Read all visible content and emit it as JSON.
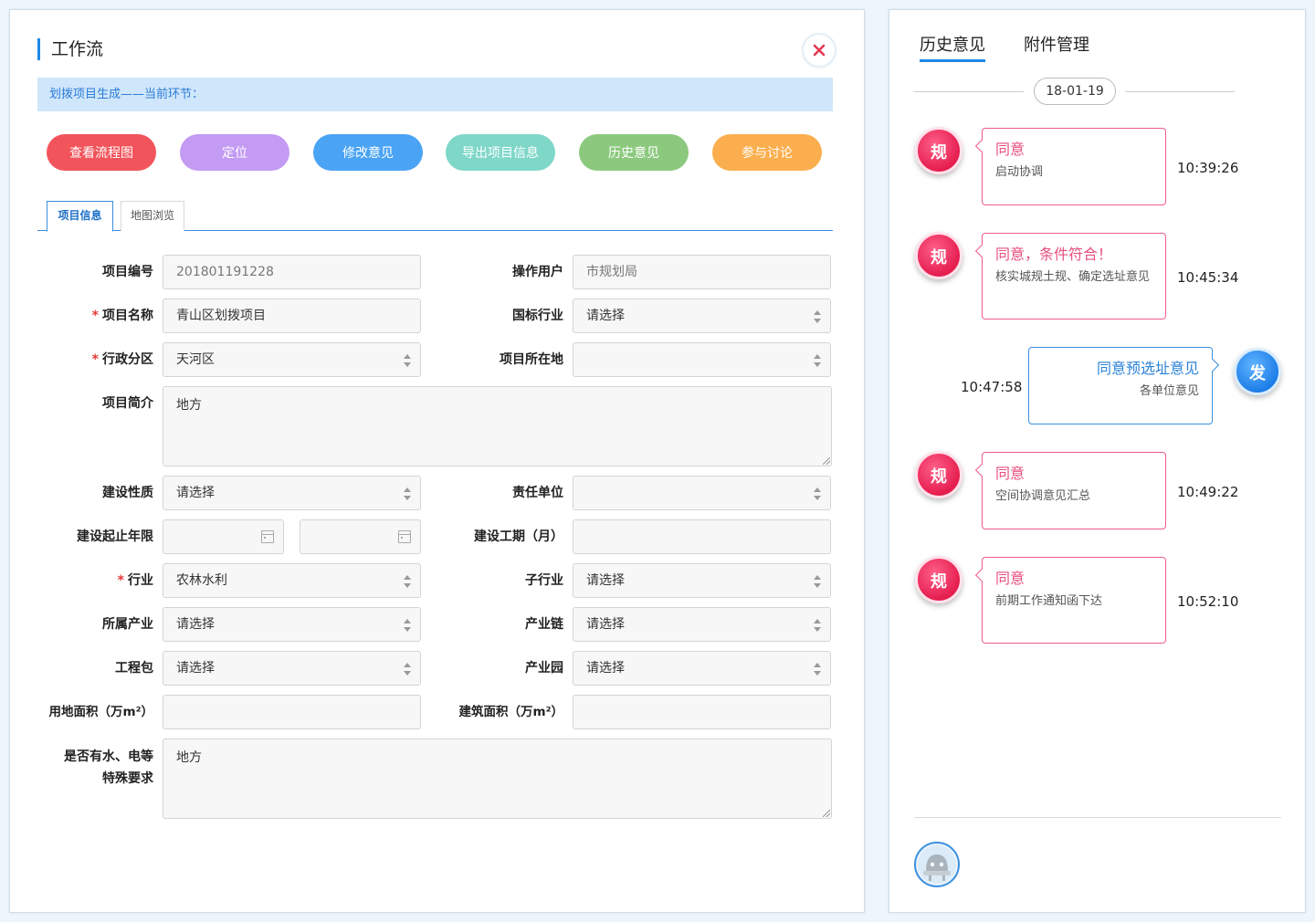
{
  "left": {
    "title": "工作流",
    "notice": "划拨项目生成——当前环节：",
    "actions": [
      {
        "label": "查看流程图",
        "color": "#f2545b"
      },
      {
        "label": "定位",
        "color": "#c39bf3"
      },
      {
        "label": "修改意见",
        "color": "#4aa3f3"
      },
      {
        "label": "导出项目信息",
        "color": "#7fd7c8"
      },
      {
        "label": "历史意见",
        "color": "#8cc97e"
      },
      {
        "label": "参与讨论",
        "color": "#fbae4d"
      }
    ],
    "tabs": [
      {
        "label": "项目信息"
      },
      {
        "label": "地图浏览"
      }
    ],
    "form": {
      "project_no": {
        "label": "项目编号",
        "value": "201801191228"
      },
      "operator": {
        "label": "操作用户",
        "value": "市规划局"
      },
      "project_name": {
        "label": "项目名称",
        "value": "青山区划拨项目",
        "required": "*"
      },
      "industry_std": {
        "label": "国标行业",
        "value": "请选择"
      },
      "district": {
        "label": "行政分区",
        "value": "天河区",
        "required": "*"
      },
      "location": {
        "label": "项目所在地",
        "value": ""
      },
      "summary": {
        "label": "项目简介",
        "value": "地方"
      },
      "build_nature": {
        "label": "建设性质",
        "value": "请选择"
      },
      "resp_unit": {
        "label": "责任单位",
        "value": ""
      },
      "build_years": {
        "label": "建设起止年限",
        "start": "",
        "end": ""
      },
      "build_period": {
        "label": "建设工期（月）",
        "value": ""
      },
      "industry": {
        "label": "行业",
        "value": "农林水利",
        "required": "*"
      },
      "sub_industry": {
        "label": "子行业",
        "value": "请选择"
      },
      "sector": {
        "label": "所属产业",
        "value": "请选择"
      },
      "chain": {
        "label": "产业链",
        "value": "请选择"
      },
      "package": {
        "label": "工程包",
        "value": "请选择"
      },
      "park": {
        "label": "产业园",
        "value": "请选择"
      },
      "land_area": {
        "label": "用地面积（万m²）",
        "value": ""
      },
      "build_area": {
        "label": "建筑面积（万m²）",
        "value": ""
      },
      "special_line1": "是否有水、电等",
      "special_line2": "特殊要求",
      "special_value": "地方"
    }
  },
  "right": {
    "tabs": [
      {
        "label": "历史意见"
      },
      {
        "label": "附件管理"
      }
    ],
    "date": "18-01-19",
    "messages": [
      {
        "avatar": "规",
        "title": "同意",
        "sub": "启动协调",
        "time": "10:39:26"
      },
      {
        "avatar": "规",
        "title": "同意，条件符合！",
        "sub": "核实城规土规、确定选址意见",
        "time": "10:45:34"
      },
      {
        "avatar": "发",
        "title": "同意预选址意见",
        "sub": "各单位意见",
        "time": "10:47:58"
      },
      {
        "avatar": "规",
        "title": "同意",
        "sub": "空间协调意见汇总",
        "time": "10:49:22"
      },
      {
        "avatar": "规",
        "title": "同意",
        "sub": "前期工作通知函下达",
        "time": "10:52:10"
      }
    ]
  }
}
